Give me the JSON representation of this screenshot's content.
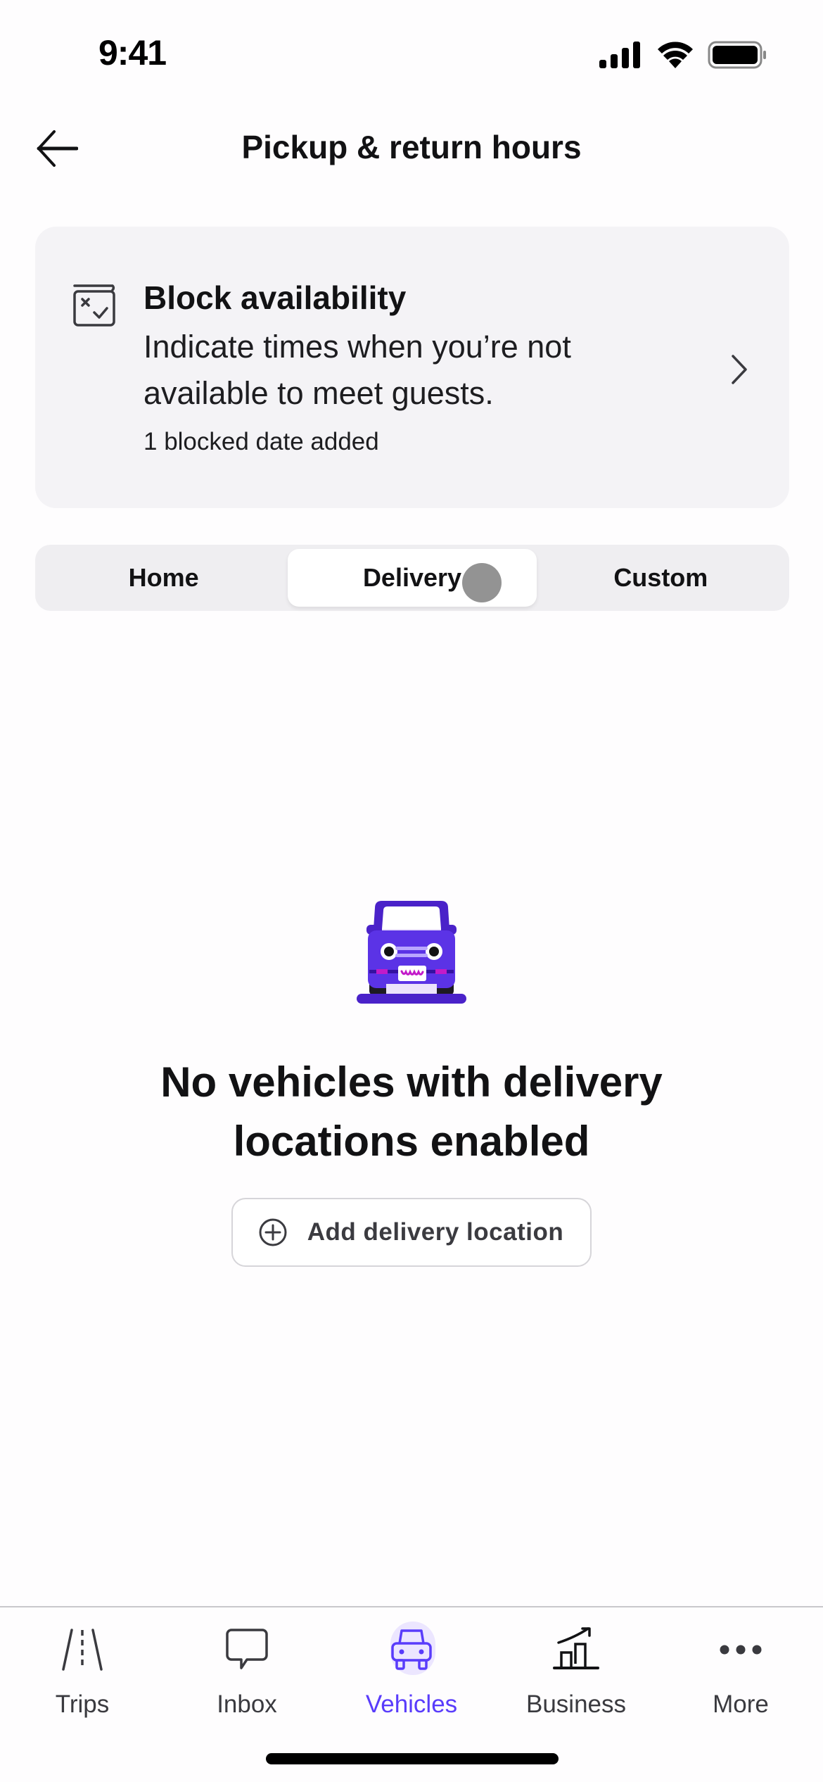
{
  "status_bar": {
    "time": "9:41",
    "icons": [
      "cellular-signal-icon",
      "wifi-icon",
      "battery-icon"
    ]
  },
  "header": {
    "back_icon": "arrow-left-icon",
    "title": "Pickup & return hours"
  },
  "block_card": {
    "icon": "calendar-x-check-icon",
    "title": "Block availability",
    "description": "Indicate times when you’re not available to meet guests.",
    "count_text": "1 blocked date added",
    "chevron_icon": "chevron-right-icon"
  },
  "segments": {
    "items": [
      {
        "label": "Home",
        "active": false
      },
      {
        "label": "Delivery",
        "active": true
      },
      {
        "label": "Custom",
        "active": false
      }
    ]
  },
  "empty_state": {
    "illustration": "car-front-illustration",
    "title": "No vehicles with delivery locations enabled",
    "button_icon": "plus-circle-icon",
    "button_label": "Add delivery location"
  },
  "tab_bar": {
    "items": [
      {
        "label": "Trips",
        "icon": "road-icon",
        "active": false
      },
      {
        "label": "Inbox",
        "icon": "chat-bubble-icon",
        "active": false
      },
      {
        "label": "Vehicles",
        "icon": "car-icon",
        "active": true
      },
      {
        "label": "Business",
        "icon": "chart-growth-icon",
        "active": false
      },
      {
        "label": "More",
        "icon": "more-dots-icon",
        "active": false
      }
    ]
  },
  "colors": {
    "accent": "#593cfb",
    "accent_light": "#ece6ff",
    "card_background": "#f4f3f6",
    "text_primary": "#121214"
  }
}
